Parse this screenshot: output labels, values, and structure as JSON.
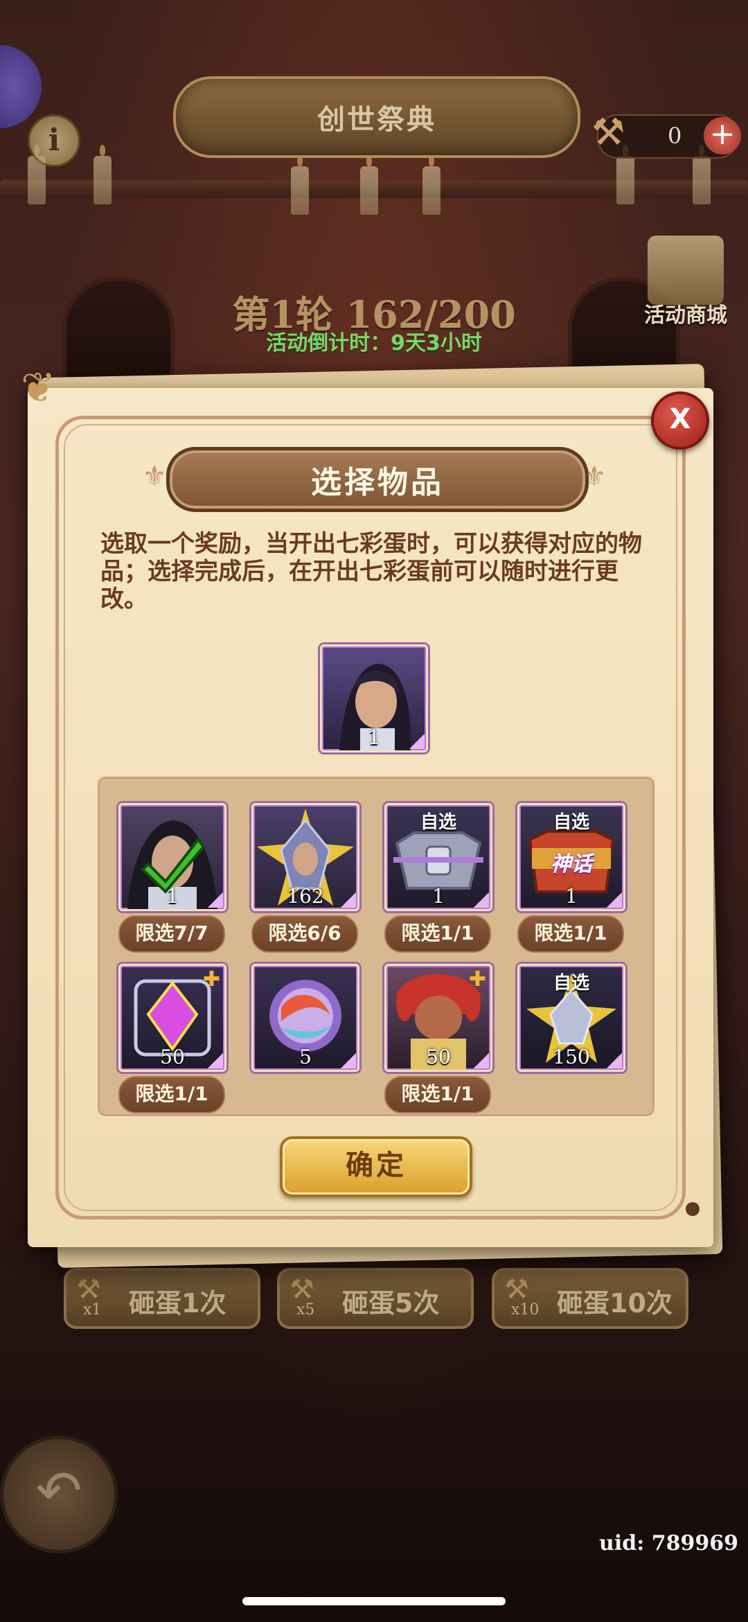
{
  "event": {
    "title": "创世祭典",
    "gavel_count": "0",
    "round_text": "第1轮 162/200",
    "countdown": "活动倒计时：9天3小时",
    "shop_label": "活动商城"
  },
  "modal": {
    "title": "选择物品",
    "description": "选取一个奖励，当开出七彩蛋时，可以获得对应的物品；选择完成后，在开出七彩蛋前可以随时进行更改。",
    "selected_qty": "1",
    "confirm_label": "确定",
    "close_label": "X",
    "items": [
      {
        "qty": "1",
        "tag": "",
        "limit": "限选7/7",
        "selected": true
      },
      {
        "qty": "162",
        "tag": "",
        "limit": "限选6/6"
      },
      {
        "qty": "1",
        "tag": "自选",
        "limit": "限选1/1",
        "icon_text": ""
      },
      {
        "qty": "1",
        "tag": "自选",
        "limit": "限选1/1",
        "icon_text": "神话"
      },
      {
        "qty": "50",
        "tag": "",
        "limit": "限选1/1"
      },
      {
        "qty": "5",
        "tag": "",
        "limit": ""
      },
      {
        "qty": "50",
        "tag": "",
        "limit": "限选1/1"
      },
      {
        "qty": "150",
        "tag": "自选",
        "limit": ""
      }
    ]
  },
  "bottom": {
    "smash1": {
      "mult": "x1",
      "label": "砸蛋1次"
    },
    "smash5": {
      "mult": "x5",
      "label": "砸蛋5次"
    },
    "smash10": {
      "mult": "x10",
      "label": "砸蛋10次"
    },
    "uid": "uid: 789969"
  }
}
